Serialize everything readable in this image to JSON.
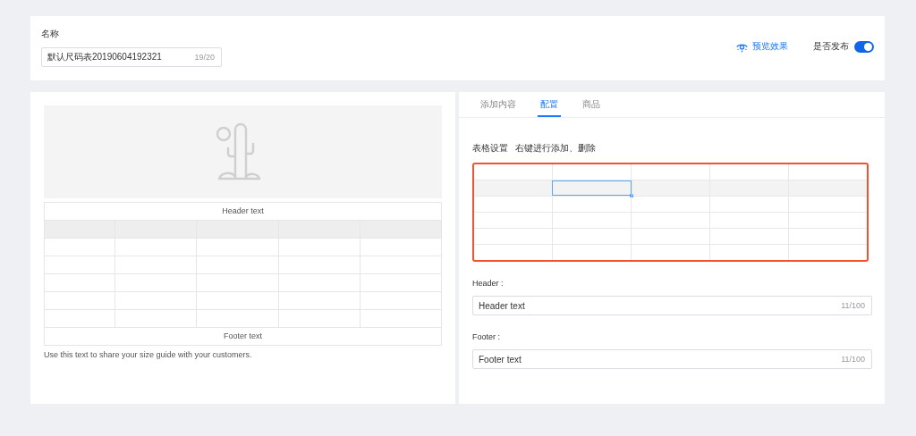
{
  "name_field": {
    "label": "名称",
    "value": "默认尺码表20190604192321",
    "counter": "19/20"
  },
  "preview_link": "预览效果",
  "publish": {
    "label": "是否发布",
    "on": true
  },
  "preview": {
    "header": "Header text",
    "footer": "Footer text",
    "note": "Use this text to share your size guide with your customers."
  },
  "tabs": [
    {
      "label": "添加内容",
      "selected": false
    },
    {
      "label": "配置",
      "selected": true
    },
    {
      "label": "商品",
      "selected": false
    }
  ],
  "table_settings": {
    "title": "表格设置",
    "hint": "右键进行添加、删除",
    "rows": [
      {
        "highlighted": false,
        "cells": [
          {
            "selected": false
          },
          {
            "selected": false
          },
          {
            "selected": false
          },
          {
            "selected": false
          },
          {
            "selected": false
          }
        ]
      },
      {
        "highlighted": true,
        "cells": [
          {
            "selected": false
          },
          {
            "selected": true
          },
          {
            "selected": false
          },
          {
            "selected": false
          },
          {
            "selected": false
          }
        ]
      },
      {
        "highlighted": false,
        "cells": [
          {
            "selected": false
          },
          {
            "selected": false
          },
          {
            "selected": false
          },
          {
            "selected": false
          },
          {
            "selected": false
          }
        ]
      },
      {
        "highlighted": false,
        "cells": [
          {
            "selected": false
          },
          {
            "selected": false
          },
          {
            "selected": false
          },
          {
            "selected": false
          },
          {
            "selected": false
          }
        ]
      },
      {
        "highlighted": false,
        "cells": [
          {
            "selected": false
          },
          {
            "selected": false
          },
          {
            "selected": false
          },
          {
            "selected": false
          },
          {
            "selected": false
          }
        ]
      },
      {
        "highlighted": false,
        "cells": [
          {
            "selected": false
          },
          {
            "selected": false
          },
          {
            "selected": false
          },
          {
            "selected": false
          },
          {
            "selected": false
          }
        ]
      }
    ]
  },
  "fields": [
    {
      "label": "Header :",
      "value": "Header text",
      "counter": "11/100"
    },
    {
      "label": "Footer :",
      "value": "Footer text",
      "counter": "11/100"
    }
  ]
}
